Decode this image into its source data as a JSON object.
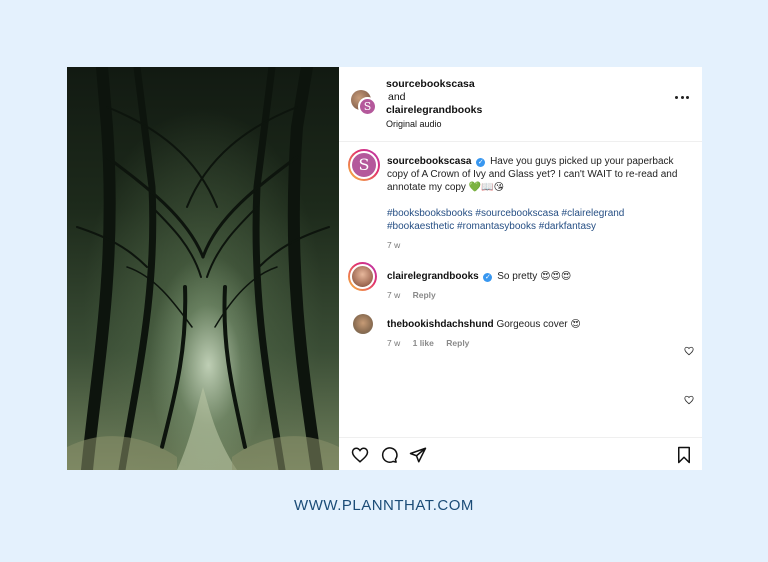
{
  "post": {
    "header": {
      "user1": "sourcebookscasa",
      "and": "and",
      "user2": "clairelegrandbooks",
      "subtitle": "Original audio",
      "avatar_letter": "S"
    },
    "caption": {
      "username": "sourcebookscasa",
      "text": "Have you guys picked up your paperback copy of A Crown of Ivy and Glass yet? I can't WAIT to re-read and annotate my copy 💚📖😘",
      "hashtags": "#booksbooksbooks #sourcebookscasa #clairelegrand #bookaesthetic #romantasybooks #darkfantasy",
      "time": "7 w"
    },
    "comments": [
      {
        "username": "clairelegrandbooks",
        "text": "So pretty 😍😍😍",
        "time": "7 w",
        "reply": "Reply"
      },
      {
        "username": "thebookishdachshund",
        "text": "Gorgeous cover 😍",
        "time": "7 w",
        "likes": "1 like",
        "reply": "Reply"
      }
    ],
    "icons": [
      "more-icon",
      "heart-icon",
      "comment-icon",
      "share-icon",
      "bookmark-icon",
      "verified-icon"
    ]
  },
  "footer": {
    "url": "WWW.PLANNTHAT.COM"
  },
  "colors": {
    "background": "#e4f1fd",
    "hashtag": "#264f84",
    "brand_footer": "#1b4c77",
    "verified": "#3897f0",
    "avatar": "#b4589b"
  }
}
